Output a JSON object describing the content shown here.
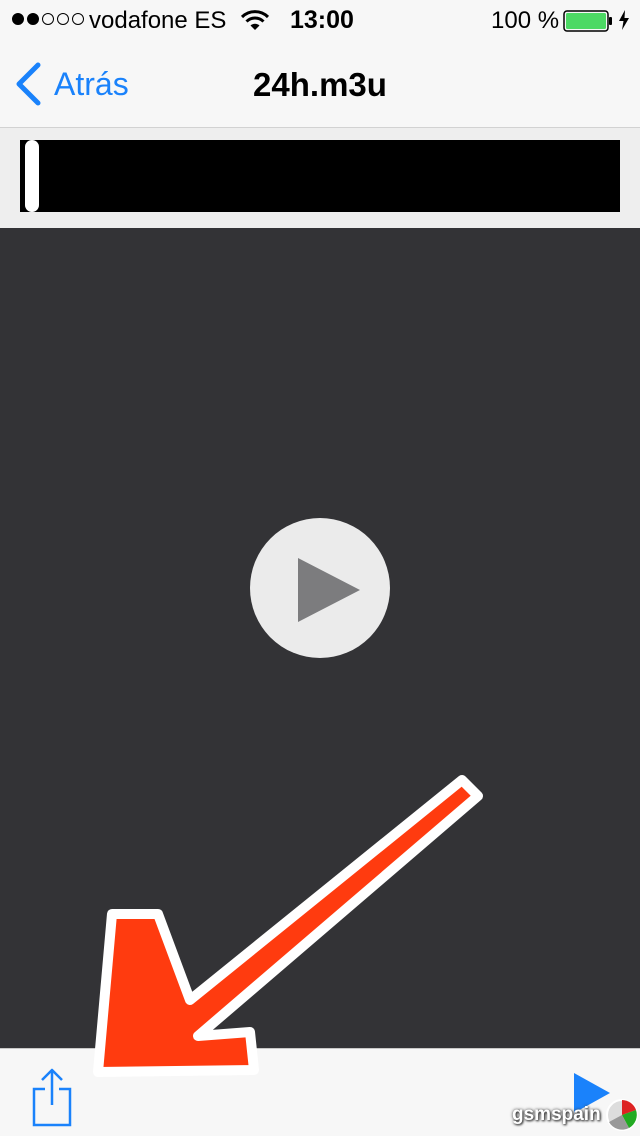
{
  "status_bar": {
    "carrier": "vodafone ES",
    "time": "13:00",
    "battery": "100 %",
    "signal_dots_filled": 2,
    "signal_dots_total": 5,
    "battery_level": 1.0,
    "battery_color": "#4cd964"
  },
  "nav": {
    "back_label": "Atrás",
    "title": "24h.m3u",
    "accent_color": "#1a82fb"
  },
  "player": {
    "playhead_position": 0.0,
    "overlay_icon": "play-circle-icon"
  },
  "toolbar": {
    "left_icon": "share-icon",
    "right_icon": "play-icon"
  },
  "annotation": {
    "icon": "arrow-annotation-icon",
    "color": "#ff3b0f"
  },
  "watermark": {
    "text": "gsmspain"
  }
}
